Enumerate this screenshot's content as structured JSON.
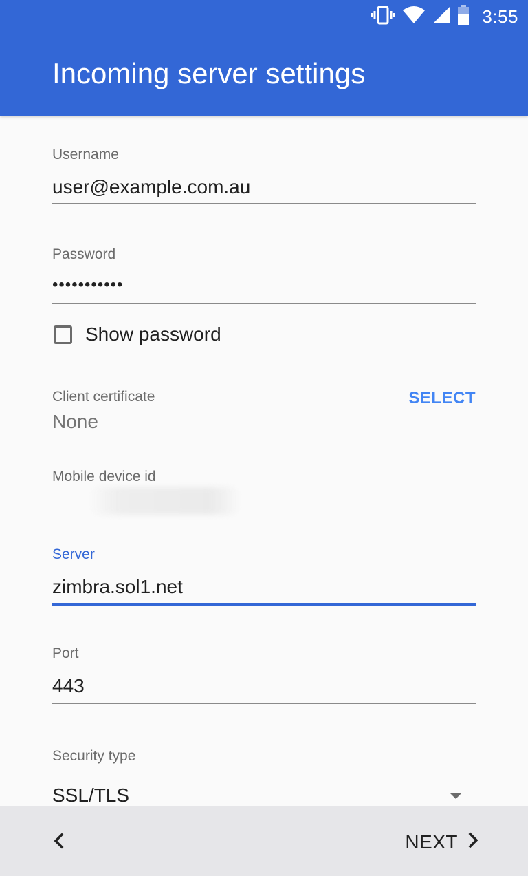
{
  "status_bar": {
    "time": "3:55",
    "icons": [
      "vibrate-icon",
      "wifi-icon",
      "cell-signal-icon",
      "battery-icon"
    ]
  },
  "app_bar": {
    "title": "Incoming server settings",
    "color": "#3367d6"
  },
  "form": {
    "username": {
      "label": "Username",
      "value": "user@example.com.au"
    },
    "password": {
      "label": "Password",
      "value": "•••••••••••"
    },
    "show_password": {
      "label": "Show password",
      "checked": false
    },
    "client_certificate": {
      "label": "Client certificate",
      "value": "None",
      "action": "SELECT"
    },
    "mobile_device_id": {
      "label": "Mobile device id"
    },
    "server": {
      "label": "Server",
      "value": "zimbra.sol1.net",
      "focused": true
    },
    "port": {
      "label": "Port",
      "value": "443"
    },
    "security_type": {
      "label": "Security type",
      "value": "SSL/TLS"
    }
  },
  "bottom_bar": {
    "back_icon": "chevron-left-icon",
    "next_label": "NEXT",
    "next_icon": "chevron-right-icon"
  },
  "colors": {
    "accent": "#3367d6",
    "select_text": "#4285f4",
    "background": "#fafafa",
    "bottom_bar": "#e6e6e9"
  }
}
